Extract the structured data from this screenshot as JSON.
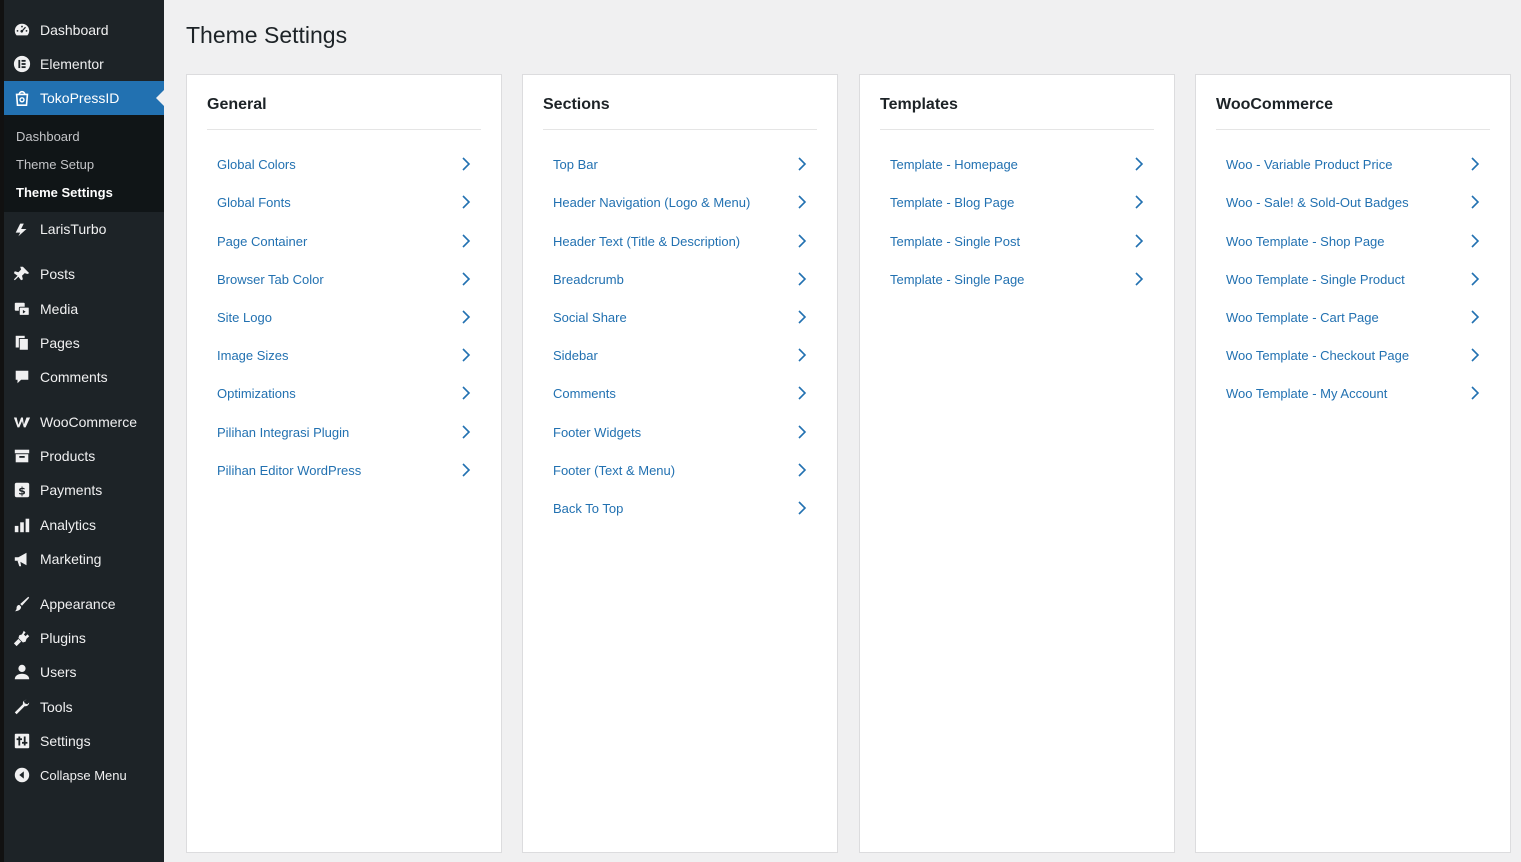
{
  "page_title": "Theme Settings",
  "sidebar": {
    "items": [
      {
        "label": "Dashboard",
        "icon": "dashboard-icon"
      },
      {
        "label": "Elementor",
        "icon": "elementor-icon"
      },
      {
        "label": "TokoPressID",
        "icon": "tokopress-icon"
      },
      {
        "label": "LarisTurbo",
        "icon": "laristurbo-icon"
      },
      {
        "label": "Posts",
        "icon": "pin-icon"
      },
      {
        "label": "Media",
        "icon": "media-icon"
      },
      {
        "label": "Pages",
        "icon": "pages-icon"
      },
      {
        "label": "Comments",
        "icon": "comment-icon"
      },
      {
        "label": "WooCommerce",
        "icon": "woocommerce-icon"
      },
      {
        "label": "Products",
        "icon": "archive-icon"
      },
      {
        "label": "Payments",
        "icon": "payments-icon"
      },
      {
        "label": "Analytics",
        "icon": "bar-chart-icon"
      },
      {
        "label": "Marketing",
        "icon": "megaphone-icon"
      },
      {
        "label": "Appearance",
        "icon": "brush-icon"
      },
      {
        "label": "Plugins",
        "icon": "plug-icon"
      },
      {
        "label": "Users",
        "icon": "user-icon"
      },
      {
        "label": "Tools",
        "icon": "wrench-icon"
      },
      {
        "label": "Settings",
        "icon": "settings-sliders-icon"
      },
      {
        "label": "Collapse Menu",
        "icon": "collapse-icon"
      }
    ],
    "submenu": [
      "Dashboard",
      "Theme Setup",
      "Theme Settings"
    ]
  },
  "cards": [
    {
      "title": "General",
      "links": [
        "Global Colors",
        "Global Fonts",
        "Page Container",
        "Browser Tab Color",
        "Site Logo",
        "Image Sizes",
        "Optimizations",
        "Pilihan Integrasi Plugin",
        "Pilihan Editor WordPress"
      ]
    },
    {
      "title": "Sections",
      "links": [
        "Top Bar",
        "Header Navigation (Logo & Menu)",
        "Header Text (Title & Description)",
        "Breadcrumb",
        "Social Share",
        "Sidebar",
        "Comments",
        "Footer Widgets",
        "Footer (Text & Menu)",
        "Back To Top"
      ]
    },
    {
      "title": "Templates",
      "links": [
        "Template - Homepage",
        "Template - Blog Page",
        "Template - Single Post",
        "Template - Single Page"
      ]
    },
    {
      "title": "WooCommerce",
      "links": [
        "Woo - Variable Product Price",
        "Woo - Sale! & Sold-Out Badges",
        "Woo Template - Shop Page",
        "Woo Template - Single Product",
        "Woo Template - Cart Page",
        "Woo Template - Checkout Page",
        "Woo Template - My Account"
      ]
    }
  ],
  "colors": {
    "sidebar_bg": "#1d2327",
    "active_bg": "#2271b1",
    "link": "#2271b1",
    "page_bg": "#f0f0f1"
  }
}
